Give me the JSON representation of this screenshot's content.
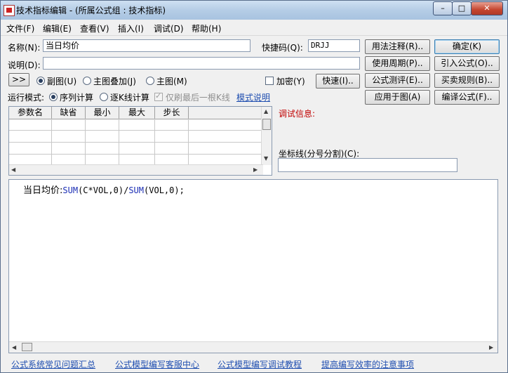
{
  "window": {
    "title": "技术指标编辑 - (所属公式组 : 技术指标)"
  },
  "titlebar_buttons": {
    "minimize": "–",
    "maximize": "□",
    "close": "✕"
  },
  "menu": [
    "文件(F)",
    "编辑(E)",
    "查看(V)",
    "插入(I)",
    "调试(D)",
    "帮助(H)"
  ],
  "form": {
    "name_label": "名称(N):",
    "name_value": "当日均价",
    "shortcut_label": "快捷码(Q):",
    "shortcut_value": "DRJJ",
    "desc_label": "说明(D):",
    "desc_value": ""
  },
  "buttons": {
    "usage_notes": "用法注释(R)..",
    "ok": "确定(K)",
    "use_period": "使用周期(P)..",
    "import_formula": "引入公式(O)..",
    "formula_test": "公式测评(E)..",
    "trade_rules": "买卖规则(B)..",
    "apply_to_chart": "应用于图(A)",
    "compile_formula": "编译公式(F)..",
    "fast": "快速(I)..",
    "expand": ">>"
  },
  "chart_type": {
    "options": [
      "副图(U)",
      "主图叠加(J)",
      "主图(M)"
    ],
    "selected": 0
  },
  "encrypt": {
    "label": "加密(Y)",
    "checked": false
  },
  "run_mode": {
    "label": "运行模式:",
    "options": [
      "序列计算",
      "逐K线计算"
    ],
    "selected": 0,
    "refresh_last_label": "仅刷最后一根K线",
    "mode_help_link": "模式说明"
  },
  "params_table": {
    "headers": [
      "参数名",
      "缺省",
      "最小",
      "最大",
      "步长"
    ]
  },
  "debug": {
    "label": "调试信息:"
  },
  "coord_line": {
    "label": "坐标线(分号分割)(C):",
    "value": ""
  },
  "editor": {
    "prefix": "当日均价:",
    "fn1": "SUM",
    "arg1": "(C*VOL,0)/",
    "fn2": "SUM",
    "arg2": "(VOL,0);"
  },
  "footer_links": [
    "公式系统常见问题汇总",
    "公式模型编写客服中心",
    "公式模型编写调试教程",
    "提高编写效率的注意事项"
  ],
  "colors": {
    "debug_label": "#c00000",
    "link": "#1f4eb0",
    "function_name": "#1c2fb5"
  }
}
